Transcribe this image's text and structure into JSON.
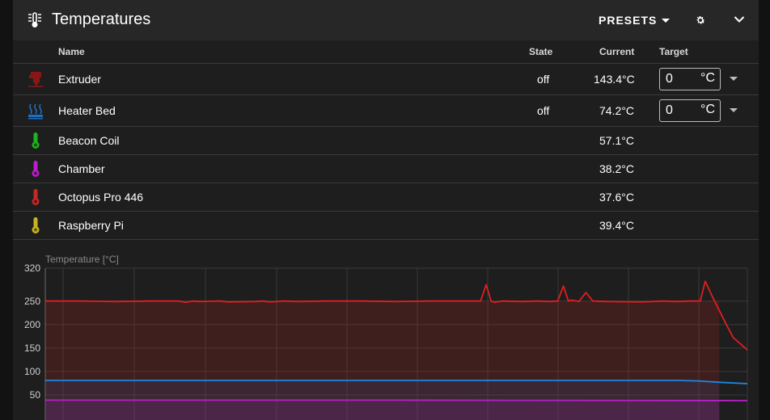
{
  "header": {
    "title": "Temperatures",
    "presets_label": "PRESETS"
  },
  "columns": {
    "name": "Name",
    "state": "State",
    "current": "Current",
    "target": "Target"
  },
  "heaters": [
    {
      "name": "Extruder",
      "icon": "extruder-icon",
      "color": "#b71c1c",
      "state": "off",
      "current": "143.4°C",
      "target": "0",
      "unit": "°C"
    },
    {
      "name": "Heater Bed",
      "icon": "heater-bed-icon",
      "color": "#1e88e5",
      "state": "off",
      "current": "74.2°C",
      "target": "0",
      "unit": "°C"
    }
  ],
  "sensors": [
    {
      "name": "Beacon Coil",
      "icon": "thermometer-icon",
      "color": "#1db31d",
      "current": "57.1°C"
    },
    {
      "name": "Chamber",
      "icon": "thermometer-icon",
      "color": "#b620c8",
      "current": "38.2°C"
    },
    {
      "name": "Octopus Pro 446",
      "icon": "thermometer-icon",
      "color": "#c62828",
      "current": "37.6°C"
    },
    {
      "name": "Raspberry Pi",
      "icon": "thermometer-icon",
      "color": "#c8b420",
      "current": "39.4°C"
    }
  ],
  "chart_data": {
    "type": "line",
    "ylabel": "Temperature [°C]",
    "ylim": [
      0,
      320
    ],
    "yticks": [
      50,
      100,
      150,
      200,
      250,
      320
    ],
    "grid": true,
    "series": [
      {
        "color": "#e01e1e",
        "x": [
          0,
          5,
          10,
          15,
          19,
          20,
          21,
          22,
          25,
          26,
          30,
          31,
          32,
          34,
          36,
          40,
          45,
          50,
          55,
          60,
          62,
          62.8,
          63.5,
          64,
          65,
          68,
          70,
          72,
          73,
          73.8,
          74.5,
          75,
          76,
          77,
          78,
          80,
          85,
          88,
          90,
          92,
          93.3,
          94,
          95,
          96,
          97,
          98,
          100
        ],
        "y": [
          250,
          250,
          249,
          250,
          250,
          247,
          250,
          249,
          250,
          248,
          249,
          250,
          248,
          250,
          249,
          250,
          250,
          249,
          250,
          250,
          250,
          285,
          250,
          247,
          250,
          249,
          250,
          249,
          250,
          282,
          250,
          252,
          249,
          268,
          250,
          249,
          248,
          250,
          249,
          250,
          250,
          292,
          260,
          230,
          200,
          172,
          146
        ]
      },
      {
        "color": "#1e88e5",
        "x": [
          0,
          90,
          93,
          96,
          100
        ],
        "y": [
          81,
          81,
          80,
          77,
          74
        ]
      },
      {
        "color": "#b620c8",
        "x": [
          0,
          50,
          100
        ],
        "y": [
          39,
          39,
          38
        ]
      }
    ],
    "target_series": [
      {
        "color": "#e01e1e",
        "x": [
          0,
          94,
          96
        ],
        "y": [
          250,
          250,
          250
        ]
      }
    ]
  }
}
